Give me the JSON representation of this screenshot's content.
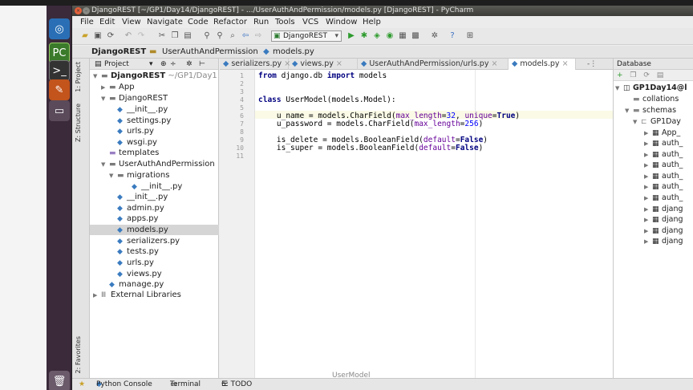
{
  "window": {
    "title": "DjangoREST [~/GP1/Day14/DjangoREST] - .../UserAuthAndPermission/models.py [DjangoREST] - PyCharm"
  },
  "menu": [
    "File",
    "Edit",
    "View",
    "Navigate",
    "Code",
    "Refactor",
    "Run",
    "Tools",
    "VCS",
    "Window",
    "Help"
  ],
  "toolbar": {
    "run_config": "DjangoREST"
  },
  "navbar": {
    "crumbs": [
      "DjangoREST",
      "UserAuthAndPermission",
      "models.py"
    ]
  },
  "side_tabs": {
    "project": "1: Project",
    "structure": "Z: Structure",
    "favorites": "2: Favorites"
  },
  "project_panel": {
    "header": "Project",
    "root_name": "DjangoREST",
    "root_path": "~/GP1/Day1",
    "items": [
      {
        "label": "App",
        "type": "folder",
        "expanded": false
      },
      {
        "label": "DjangoREST",
        "type": "folder",
        "expanded": true
      },
      {
        "label": "__init__.py",
        "type": "py"
      },
      {
        "label": "settings.py",
        "type": "py"
      },
      {
        "label": "urls.py",
        "type": "py"
      },
      {
        "label": "wsgi.py",
        "type": "py"
      },
      {
        "label": "templates",
        "type": "folder-plain"
      },
      {
        "label": "UserAuthAndPermission",
        "type": "folder",
        "expanded": true
      },
      {
        "label": "migrations",
        "type": "folder",
        "expanded": true
      },
      {
        "label": "__init__.py",
        "type": "py"
      },
      {
        "label": "__init__.py",
        "type": "py"
      },
      {
        "label": "admin.py",
        "type": "py"
      },
      {
        "label": "apps.py",
        "type": "py"
      },
      {
        "label": "models.py",
        "type": "py",
        "selected": true
      },
      {
        "label": "serializers.py",
        "type": "py"
      },
      {
        "label": "tests.py",
        "type": "py"
      },
      {
        "label": "urls.py",
        "type": "py"
      },
      {
        "label": "views.py",
        "type": "py"
      },
      {
        "label": "manage.py",
        "type": "py"
      },
      {
        "label": "External Libraries",
        "type": "lib",
        "expanded": false
      }
    ]
  },
  "editor": {
    "tabs": [
      {
        "label": "serializers.py"
      },
      {
        "label": "views.py"
      },
      {
        "label": "UserAuthAndPermission/urls.py"
      },
      {
        "label": "models.py",
        "active": true
      }
    ],
    "tab_overflow": "-⋮",
    "line_numbers": [
      "1",
      "2",
      "3",
      "4",
      "5",
      "6",
      "7",
      "8",
      "9",
      "10",
      "11"
    ],
    "class_hint": "UserModel"
  },
  "database_panel": {
    "header": "Database",
    "items": [
      {
        "label": "GP1Day14@l",
        "bold": true
      },
      {
        "label": "collations"
      },
      {
        "label": "schemas"
      },
      {
        "label": "GP1Day"
      },
      {
        "label": "App_"
      },
      {
        "label": "auth_"
      },
      {
        "label": "auth_"
      },
      {
        "label": "auth_"
      },
      {
        "label": "auth_"
      },
      {
        "label": "auth_"
      },
      {
        "label": "auth_"
      },
      {
        "label": "djang"
      },
      {
        "label": "djang"
      },
      {
        "label": "djang"
      },
      {
        "label": "djang"
      }
    ]
  },
  "bottom": {
    "python_console": "Python Console",
    "terminal": "Terminal",
    "todo": "6: TODO"
  },
  "colors": {
    "launcher_bg": "#3a2a3a",
    "keyword": "#000080",
    "string": "#008080",
    "kwarg": "#660099",
    "number": "#0000ff"
  }
}
